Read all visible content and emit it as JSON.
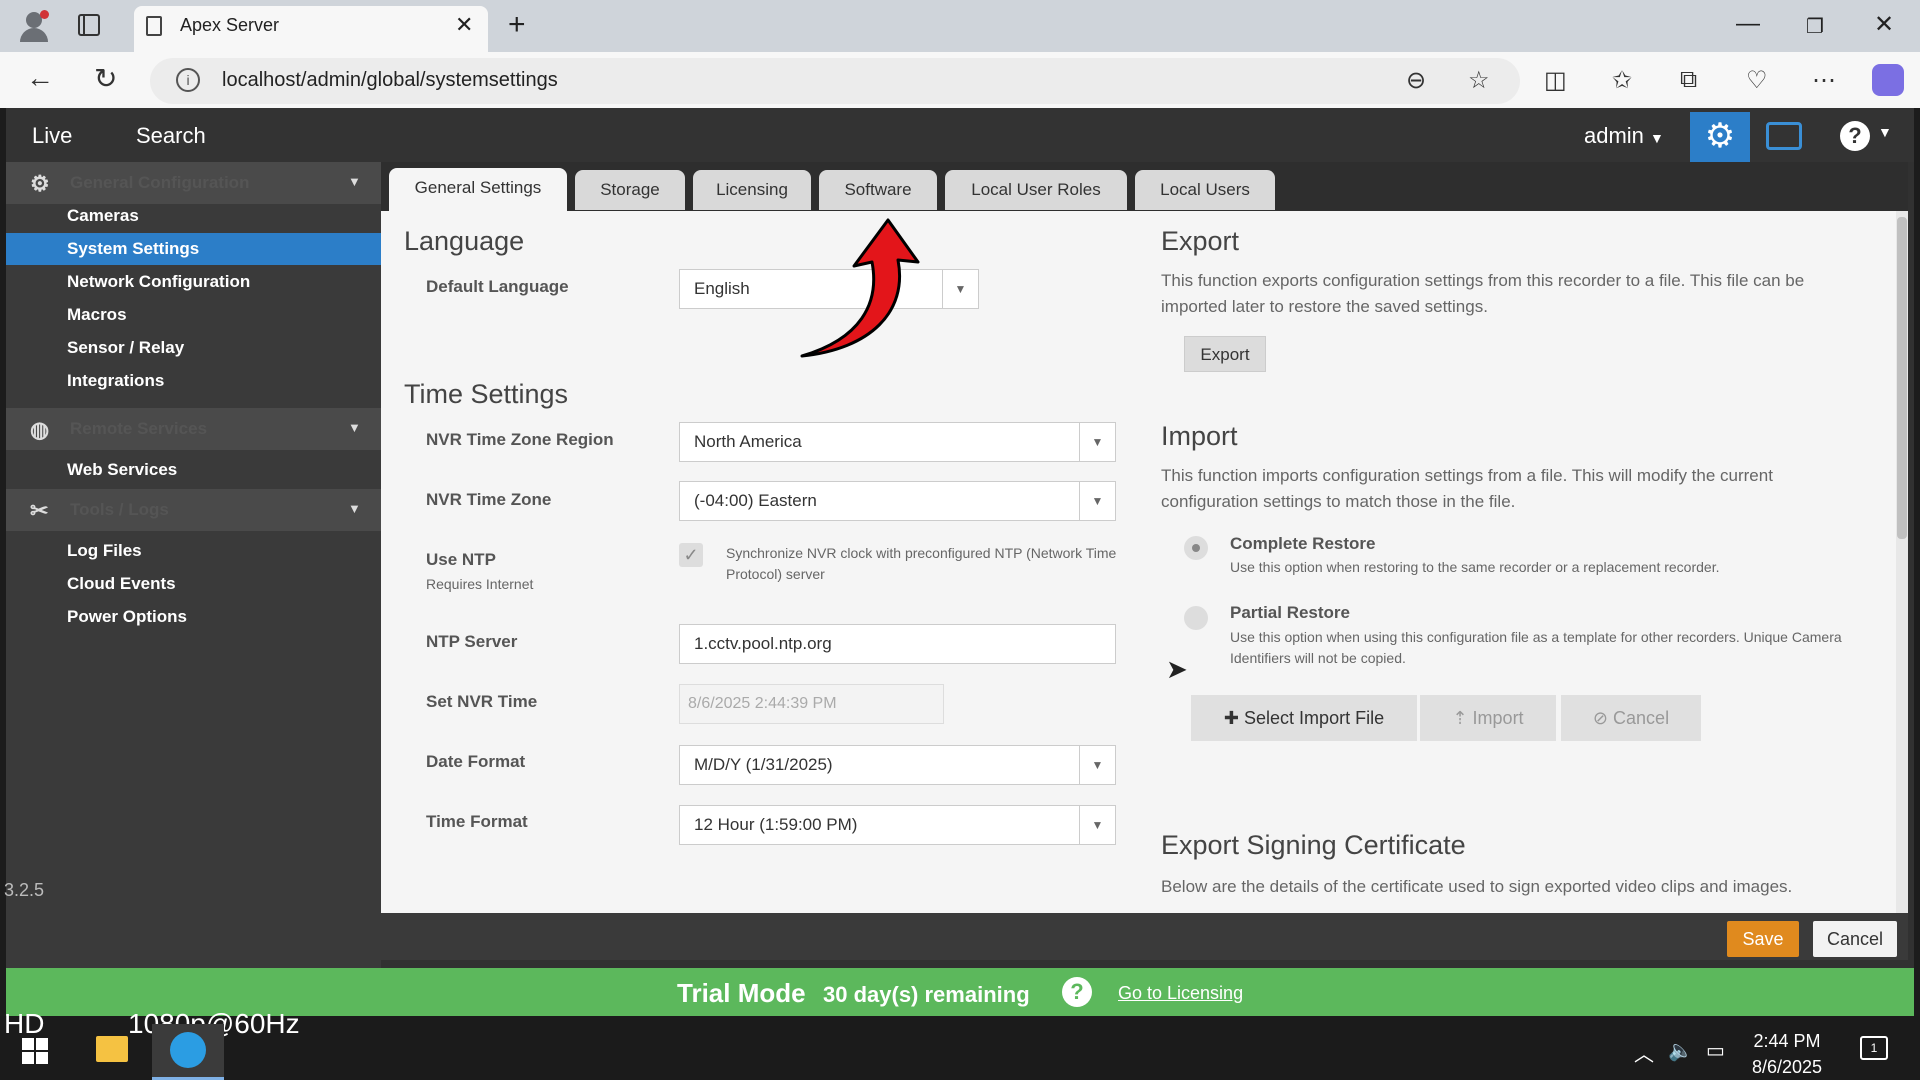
{
  "browser": {
    "tab_title": "Apex Server",
    "url": "localhost/admin/global/systemsettings"
  },
  "topnav": {
    "live": "Live",
    "search": "Search",
    "user": "admin"
  },
  "sidebar": {
    "sections": [
      {
        "label": "General Configuration",
        "icon": "gear-icon"
      },
      {
        "label": "Remote Services",
        "icon": "globe-icon"
      },
      {
        "label": "Tools / Logs",
        "icon": "tools-icon"
      }
    ],
    "items": {
      "cameras": "Cameras",
      "system_settings": "System Settings",
      "network": "Network Configuration",
      "macros": "Macros",
      "sensor": "Sensor / Relay",
      "integrations": "Integrations",
      "web_services": "Web Services",
      "log_files": "Log Files",
      "cloud_events": "Cloud Events",
      "power_options": "Power Options"
    },
    "version": "3.2.5"
  },
  "tabs": [
    "General Settings",
    "Storage",
    "Licensing",
    "Software",
    "Local User Roles",
    "Local Users"
  ],
  "language": {
    "heading": "Language",
    "default_language_label": "Default Language",
    "default_language_value": "English"
  },
  "time": {
    "heading": "Time Settings",
    "region_label": "NVR Time Zone Region",
    "region_value": "North America",
    "zone_label": "NVR Time Zone",
    "zone_value": "(-04:00) Eastern",
    "ntp_label": "Use NTP",
    "ntp_sub": "Requires Internet",
    "ntp_checkbox_text": "Synchronize NVR clock with preconfigured NTP (Network Time Protocol) server",
    "ntp_server_label": "NTP Server",
    "ntp_server_value": "1.cctv.pool.ntp.org",
    "set_time_label": "Set NVR Time",
    "set_time_value": "8/6/2025 2:44:39 PM",
    "date_format_label": "Date Format",
    "date_format_value": "M/D/Y (1/31/2025)",
    "time_format_label": "Time Format",
    "time_format_value": "12 Hour (1:59:00 PM)"
  },
  "export": {
    "heading": "Export",
    "description": "This function exports configuration settings from this recorder to a file. This file can be imported later to restore the saved settings.",
    "button": "Export"
  },
  "import": {
    "heading": "Import",
    "description": "This function imports configuration settings from a file. This will modify the current configuration settings to match those in the file.",
    "complete_label": "Complete Restore",
    "complete_desc": "Use this option when restoring to the same recorder or a replacement recorder.",
    "partial_label": "Partial Restore",
    "partial_desc": "Use this option when using this configuration file as a template for other recorders. Unique Camera Identifiers will not be copied.",
    "select_file": "Select Import File",
    "import_btn": "Import",
    "cancel_btn": "Cancel"
  },
  "cert": {
    "heading": "Export Signing Certificate",
    "description": "Below are the details of the certificate used to sign exported video clips and images."
  },
  "footer": {
    "save": "Save",
    "cancel": "Cancel"
  },
  "trial": {
    "title": "Trial Mode",
    "days": "30 day(s) remaining",
    "link": "Go to Licensing"
  },
  "taskbar": {
    "hd": "HD",
    "resolution": "1080p@60Hz",
    "time": "2:44 PM",
    "date": "8/6/2025",
    "notifications": "1"
  },
  "colors": {
    "accent": "#2c7ec8",
    "save": "#e08a1e",
    "trial": "#5cb85c",
    "annotation_arrow": "#e3151a"
  }
}
